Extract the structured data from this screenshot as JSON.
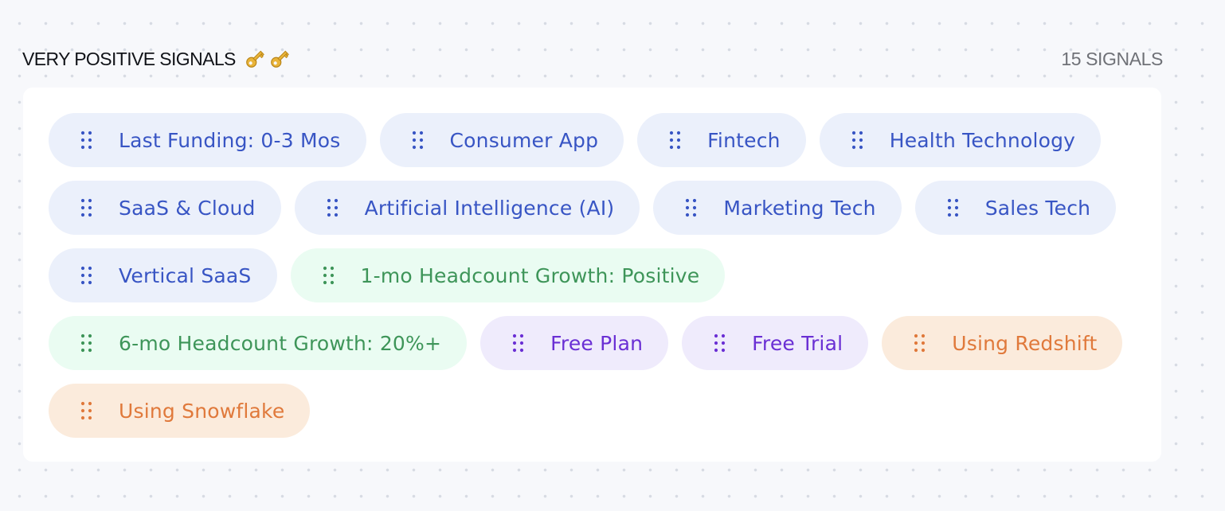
{
  "section": {
    "title": "VERY POSITIVE SIGNALS",
    "title_icon": "key-icon",
    "count_label": "15 SIGNALS"
  },
  "colors": {
    "blue": "#3855c4",
    "blue_bg": "#ebf0fb",
    "green": "#3e9559",
    "green_bg": "#eafcf2",
    "purple": "#6a2fd4",
    "purple_bg": "#efebfc",
    "orange": "#e0793b",
    "orange_bg": "#fbebdc"
  },
  "signals": [
    {
      "label": "Last Funding: 0-3 Mos",
      "color": "blue",
      "icon": "drag-handle-icon"
    },
    {
      "label": "Consumer App",
      "color": "blue",
      "icon": "drag-handle-icon"
    },
    {
      "label": "Fintech",
      "color": "blue",
      "icon": "drag-handle-icon"
    },
    {
      "label": "Health Technology",
      "color": "blue",
      "icon": "drag-handle-icon"
    },
    {
      "label": "SaaS & Cloud",
      "color": "blue",
      "icon": "drag-handle-icon"
    },
    {
      "label": "Artificial Intelligence (AI)",
      "color": "blue",
      "icon": "drag-handle-icon"
    },
    {
      "label": "Marketing Tech",
      "color": "blue",
      "icon": "drag-handle-icon"
    },
    {
      "label": "Sales Tech",
      "color": "blue",
      "icon": "drag-handle-icon"
    },
    {
      "label": "Vertical SaaS",
      "color": "blue",
      "icon": "drag-handle-icon"
    },
    {
      "label": "1-mo Headcount Growth: Positive",
      "color": "green",
      "icon": "drag-handle-icon"
    },
    {
      "label": "6-mo Headcount Growth: 20%+",
      "color": "green",
      "icon": "drag-handle-icon"
    },
    {
      "label": "Free Plan",
      "color": "purple",
      "icon": "drag-handle-icon"
    },
    {
      "label": "Free Trial",
      "color": "purple",
      "icon": "drag-handle-icon"
    },
    {
      "label": "Using Redshift",
      "color": "orange",
      "icon": "drag-handle-icon"
    },
    {
      "label": "Using Snowflake",
      "color": "orange",
      "icon": "drag-handle-icon"
    }
  ]
}
